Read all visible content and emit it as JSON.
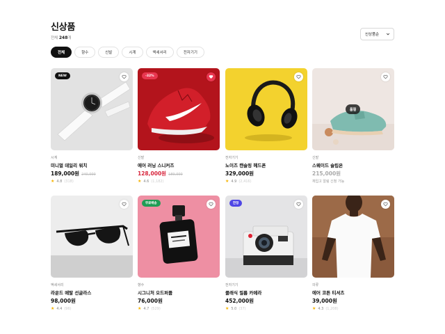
{
  "page": {
    "title": "신상품",
    "count_prefix": "전체",
    "count_value": "248",
    "count_suffix": "개"
  },
  "sort": {
    "label": "신상품순"
  },
  "chips": [
    {
      "label": "전체",
      "active": true
    },
    {
      "label": "향수",
      "active": false
    },
    {
      "label": "신발",
      "active": false
    },
    {
      "label": "시계",
      "active": false
    },
    {
      "label": "액세서리",
      "active": false
    },
    {
      "label": "전자기기",
      "active": false
    }
  ],
  "products": [
    {
      "category": "시계",
      "name": "미니멀 데일리 워치",
      "price": "189,000원",
      "original_price": "240,000",
      "rating": "4.8",
      "reviews": "(318)",
      "badge": "NEW",
      "badge_color": "#111111",
      "liked": false
    },
    {
      "category": "신발",
      "name": "에어 러닝 스니커즈",
      "price": "128,000원",
      "original_price": "189,000",
      "rating": "4.6",
      "reviews": "(1,182)",
      "badge": "-32%",
      "badge_color": "#e8364f",
      "liked": true
    },
    {
      "category": "전자기기",
      "name": "노이즈 캔슬링 헤드폰",
      "price": "329,000원",
      "original_price": "",
      "rating": "4.9",
      "reviews": "(2,416)",
      "badge": "",
      "liked": false
    },
    {
      "category": "신발",
      "name": "스웨이드 슬립온",
      "price": "215,000원",
      "original_price": "",
      "note": "재입고 알림 신청 가능",
      "badge": "",
      "soldout": "품절",
      "liked": false
    },
    {
      "category": "액세서리",
      "name": "라운드 메탈 선글라스",
      "price": "98,000원",
      "original_price": "",
      "rating": "4.4",
      "reviews": "(96)",
      "badge": "",
      "liked": false
    },
    {
      "category": "향수",
      "name": "시그니처 오드퍼퓸",
      "price": "76,000원",
      "original_price": "",
      "rating": "4.7",
      "reviews": "(529)",
      "badge": "무료배송",
      "badge_color": "#1f9d55",
      "liked": false
    },
    {
      "category": "전자기기",
      "name": "클래식 필름 카메라",
      "price": "452,000원",
      "original_price": "",
      "rating": "5.0",
      "reviews": "(37)",
      "badge": "한정",
      "badge_color": "#4f46e5",
      "liked": false
    },
    {
      "category": "의류",
      "name": "에어 코튼 티셔츠",
      "price": "39,000원",
      "original_price": "",
      "rating": "4.3",
      "reviews": "(1,208)",
      "badge": "",
      "liked": false
    }
  ]
}
